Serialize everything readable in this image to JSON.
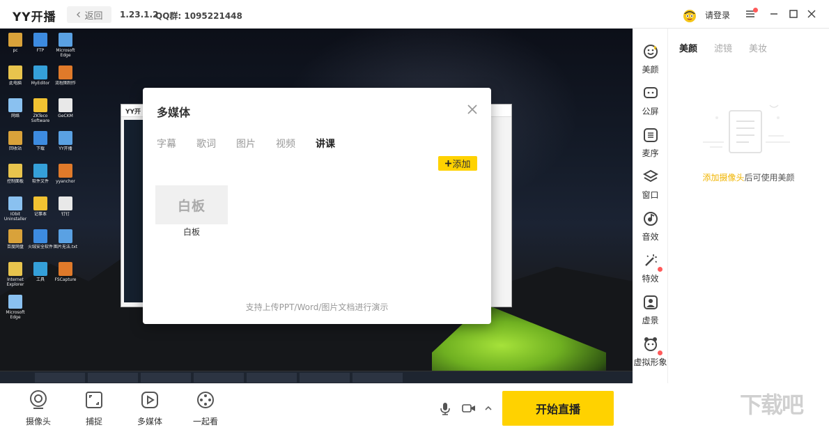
{
  "topbar": {
    "logo": "YY开播",
    "back_label": "返回",
    "version": "1.23.1.2",
    "qq": "QQ群: 1095221448",
    "login": "请登录"
  },
  "modal": {
    "title": "多媒体",
    "tabs": [
      "字幕",
      "歌词",
      "图片",
      "视频",
      "讲课"
    ],
    "active_tab": "讲课",
    "add_label": "添加",
    "whiteboard_thumb": "白板",
    "whiteboard_label": "白板",
    "hint": "支持上传PPT/Word/图片文档进行演示"
  },
  "tools": [
    {
      "label": "美颜",
      "icon": "beauty-icon"
    },
    {
      "label": "公屏",
      "icon": "chat-icon"
    },
    {
      "label": "麦序",
      "icon": "queue-icon"
    },
    {
      "label": "窗口",
      "icon": "layers-icon"
    },
    {
      "label": "音效",
      "icon": "sound-icon"
    },
    {
      "label": "特效",
      "icon": "magic-wand-icon"
    },
    {
      "label": "虚景",
      "icon": "virtual-bg-icon"
    },
    {
      "label": "虚拟形象",
      "icon": "avatar-icon"
    }
  ],
  "right_panel": {
    "tabs": [
      "美颜",
      "滤镜",
      "美妆"
    ],
    "active_tab": "美颜",
    "msg_link": "添加摄像头",
    "msg_rest": "后可使用美颜"
  },
  "bottom": {
    "buttons": [
      {
        "label": "摄像头",
        "icon": "camera-icon"
      },
      {
        "label": "捕捉",
        "icon": "capture-icon"
      },
      {
        "label": "多媒体",
        "icon": "media-icon"
      },
      {
        "label": "一起看",
        "icon": "watch-together-icon"
      }
    ],
    "start_label": "开始直播"
  },
  "colors": {
    "accent": "#ffd200",
    "highlight": "#f0b400",
    "notify": "#ff5a5a"
  },
  "desktop": {
    "icons": [
      "pc",
      "FTP",
      "Microsoft Edge",
      "此电脑",
      "MyEditor",
      "流程图制作",
      "网络",
      "ZKTeco Software",
      "GeCKM",
      "回收站",
      "下载",
      "YY开播",
      "控制面板",
      "软件文件",
      "yyanchor",
      "IObit Uninstaller",
      "记事本",
      "钉钉",
      "百度网盘",
      "火绒安全软件",
      "图片无法.txt",
      "Internet Explorer",
      "工具",
      "FSCapture",
      "Microsoft Edge"
    ],
    "inner_title": "YY开"
  },
  "watermark": "下载吧"
}
